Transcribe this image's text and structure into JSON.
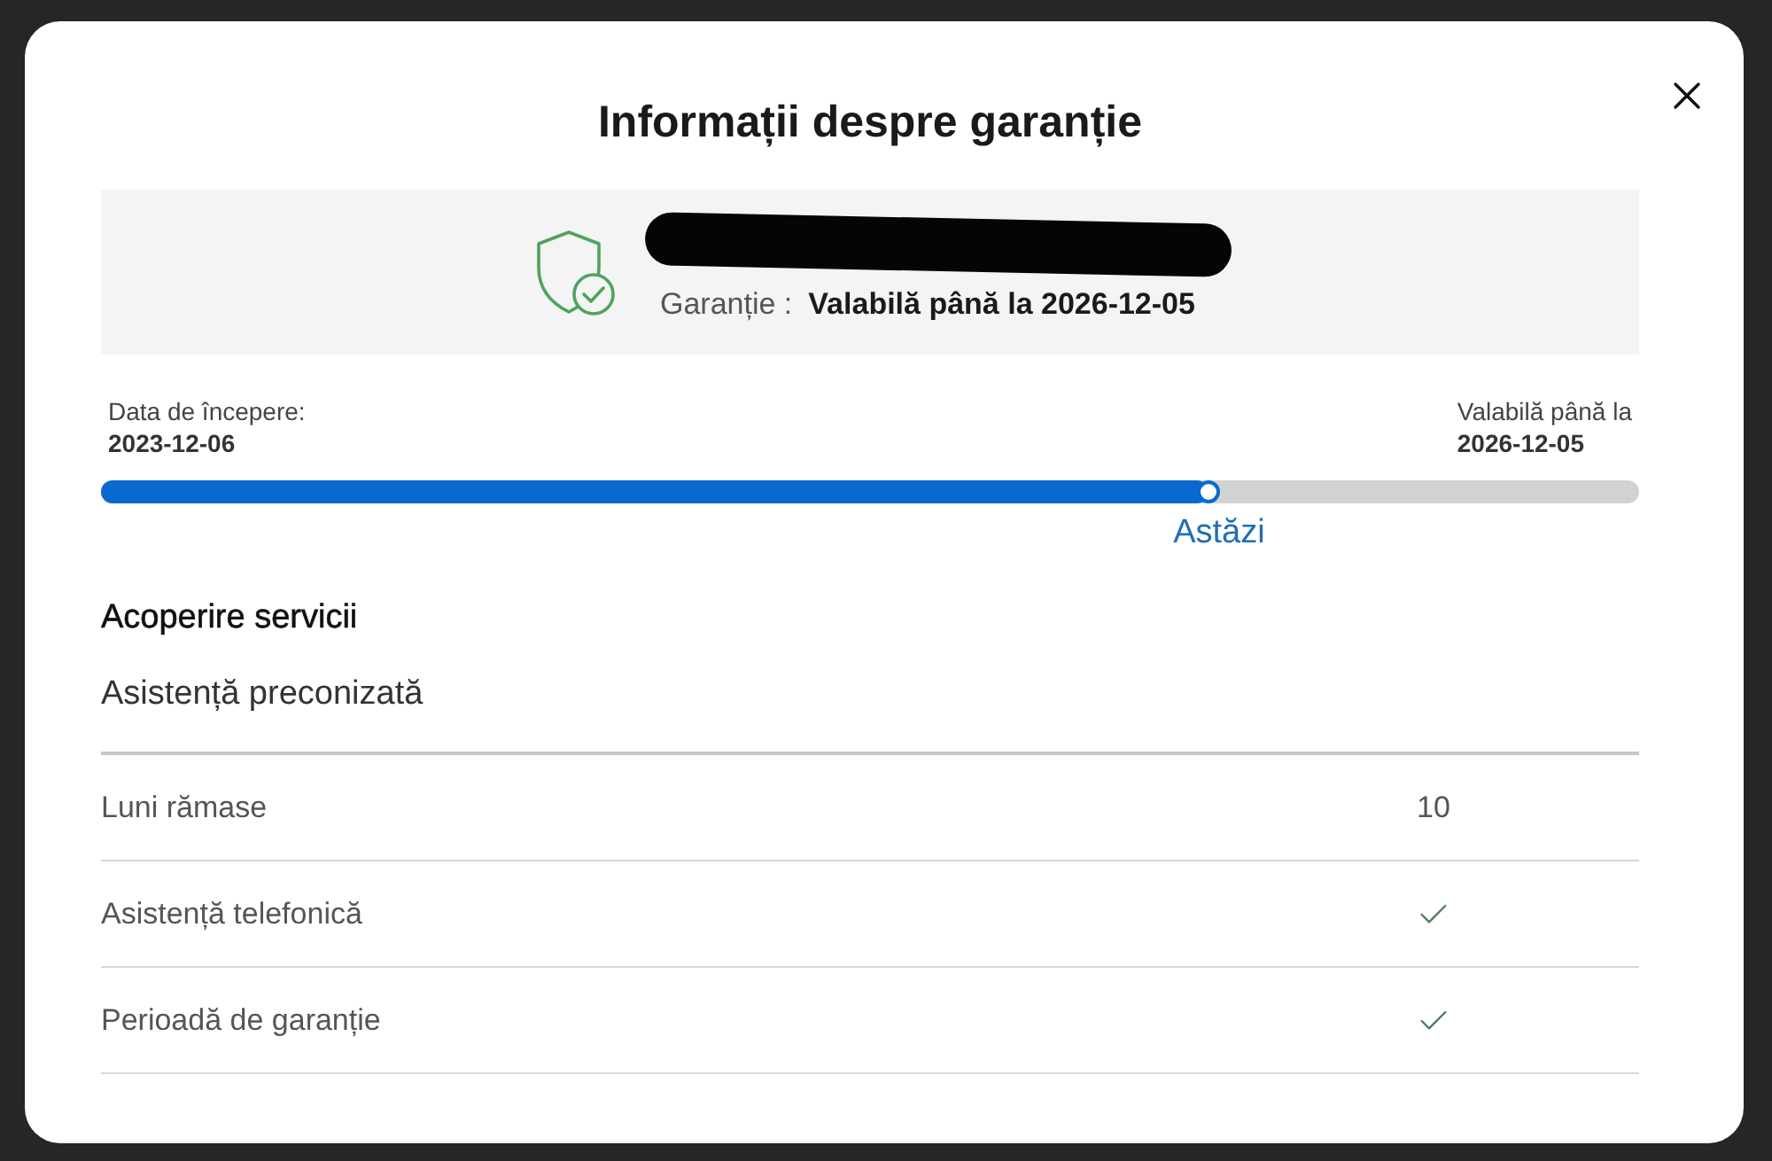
{
  "dialog": {
    "title": "Informații despre garanție"
  },
  "warranty_summary": {
    "label": "Garanție :",
    "value": "Valabilă până la 2026-12-05"
  },
  "timeline": {
    "start_label": "Data de începere:",
    "start_date": "2023-12-06",
    "end_label": "Valabilă până la",
    "end_date": "2026-12-05",
    "level": 0.72,
    "today_label": "Astăzi"
  },
  "coverage": {
    "title": "Acoperire servicii",
    "subtitle": "Asistență preconizată",
    "rows": [
      {
        "kind": "text",
        "label": "Luni rămase",
        "value": "10"
      },
      {
        "kind": "check",
        "label": "Asistență telefonică",
        "checked": true
      },
      {
        "kind": "check",
        "label": "Perioadă de garanție",
        "checked": true
      }
    ]
  }
}
